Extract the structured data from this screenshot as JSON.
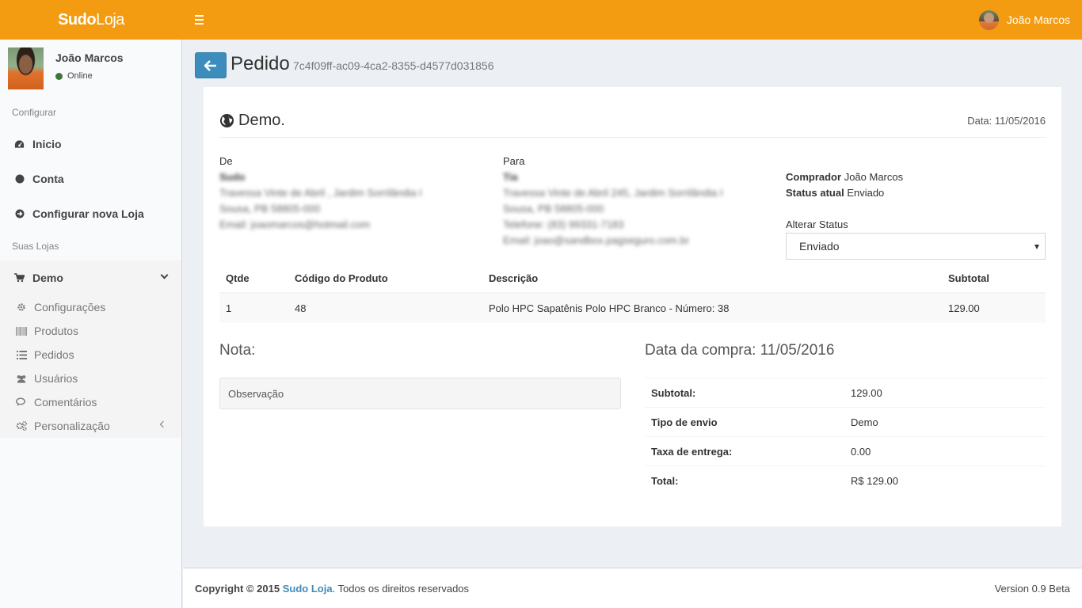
{
  "header": {
    "logo_bold": "Sudo",
    "logo_light": "Loja",
    "user_name": "João Marcos"
  },
  "sidebar": {
    "user_name": "João Marcos",
    "user_status": "Online",
    "section_configurar": "Configurar",
    "items": [
      {
        "label": "Inicio",
        "icon": "dashboard-icon"
      },
      {
        "label": "Conta",
        "icon": "circle-icon"
      },
      {
        "label": "Configurar nova Loja",
        "icon": "arrow-circle-right-icon"
      }
    ],
    "section_lojas": "Suas Lojas",
    "store": {
      "label": "Demo",
      "icon": "cart-icon"
    },
    "sub_items": [
      {
        "label": "Configurações",
        "icon": "gear-icon"
      },
      {
        "label": "Produtos",
        "icon": "barcode-icon"
      },
      {
        "label": "Pedidos",
        "icon": "list-icon"
      },
      {
        "label": "Usuários",
        "icon": "users-icon"
      },
      {
        "label": "Comentários",
        "icon": "comments-icon"
      },
      {
        "label": "Personalização",
        "icon": "gears-icon"
      }
    ]
  },
  "page": {
    "title": "Pedido",
    "subtitle": "7c4f09ff-ac09-4ca2-8355-d4577d031856"
  },
  "invoice": {
    "store_name": "Demo.",
    "date": "Data: 11/05/2016",
    "from": {
      "label": "De",
      "lines": [
        "Sudo",
        "Travessa Vinte de Abril , Jardim Sorrilândia I",
        "Sousa, PB 58805-000",
        "Email: joaomarcos@hotmail.com"
      ]
    },
    "to": {
      "label": "Para",
      "lines": [
        "Tia",
        "Travessa Vinte de Abril 245, Jardim Sorrilândia I",
        "Sousa, PB 58805-000",
        "Telefone: (83) 99331-7183",
        "Email: joao@sandbox.pagseguro.com.br"
      ]
    },
    "buyer_label": "Comprador",
    "buyer_value": "João Marcos",
    "status_label": "Status atual",
    "status_value": "Enviado",
    "alter_status_label": "Alterar Status",
    "alter_status_selected": "Enviado",
    "table": {
      "headers": [
        "Qtde",
        "Código do Produto",
        "Descrição",
        "Subtotal"
      ],
      "rows": [
        [
          "1",
          "48",
          "Polo HPC Sapatênis Polo HPC Branco - Número: 38",
          "129.00"
        ]
      ]
    },
    "note_title": "Nota:",
    "note_placeholder": "Observação",
    "purchase_title": "Data da compra: 11/05/2016",
    "summary": [
      {
        "label": "Subtotal:",
        "value": "129.00"
      },
      {
        "label": "Tipo de envio",
        "value": "Demo"
      },
      {
        "label": "Taxa de entrega:",
        "value": "0.00"
      },
      {
        "label": "Total:",
        "value": "R$ 129.00"
      }
    ]
  },
  "footer": {
    "copyright": "Copyright © 2015",
    "brand": "Sudo Loja",
    "rights": ". Todos os direitos reservados",
    "version": "Version 0.9 Beta"
  },
  "colors": {
    "header": "#f39c12",
    "primary": "#3c8dbc",
    "online": "#3c763d"
  }
}
